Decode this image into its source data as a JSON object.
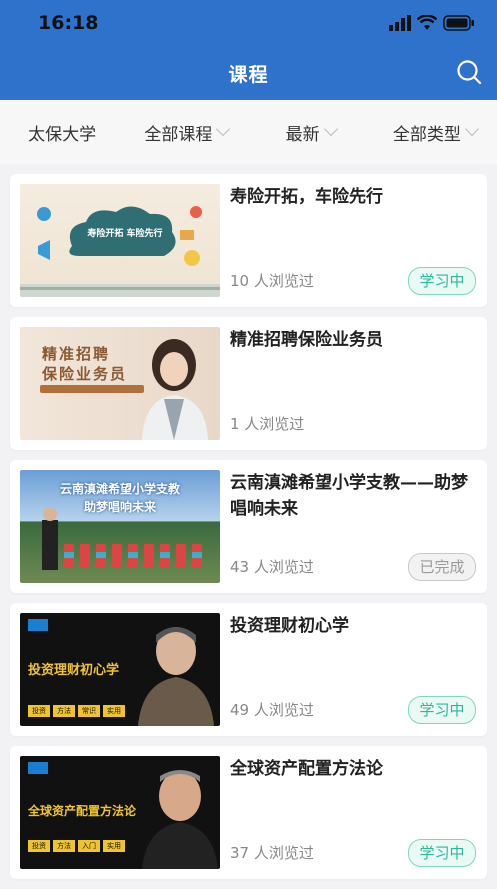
{
  "status": {
    "time": "16:18"
  },
  "header": {
    "title": "课程"
  },
  "filters": [
    {
      "label": "太保大学",
      "dropdown": false
    },
    {
      "label": "全部课程",
      "dropdown": true
    },
    {
      "label": "最新",
      "dropdown": true
    },
    {
      "label": "全部类型",
      "dropdown": true
    }
  ],
  "courses": [
    {
      "title": "寿险开拓，车险先行",
      "views": "10 人浏览过",
      "status": "学习中",
      "thumb": {
        "line1": "寿险开拓 车险先行"
      }
    },
    {
      "title": "精准招聘保险业务员",
      "views": "1 人浏览过",
      "status": "",
      "thumb": {
        "line1": "精准招聘",
        "line2": "保险业务员"
      }
    },
    {
      "title": "云南滇滩希望小学支教——助梦唱响未来",
      "views": "43 人浏览过",
      "status": "已完成",
      "thumb": {
        "line1": "云南滇滩希望小学支教",
        "line2": "助梦唱响未来"
      }
    },
    {
      "title": "投资理财初心学",
      "views": "49 人浏览过",
      "status": "学习中",
      "thumb": {
        "line1": "投资理财初心学",
        "tags": [
          "投资",
          "方法",
          "常识",
          "实用"
        ]
      }
    },
    {
      "title": "全球资产配置方法论",
      "views": "37 人浏览过",
      "status": "学习中",
      "thumb": {
        "line1": "全球资产配置方法论",
        "tags": [
          "投资",
          "方法",
          "入门",
          "实用"
        ]
      }
    }
  ],
  "colors": {
    "primary": "#2f72cc",
    "learning": "#2cb89b",
    "done": "#9a9a9a"
  }
}
